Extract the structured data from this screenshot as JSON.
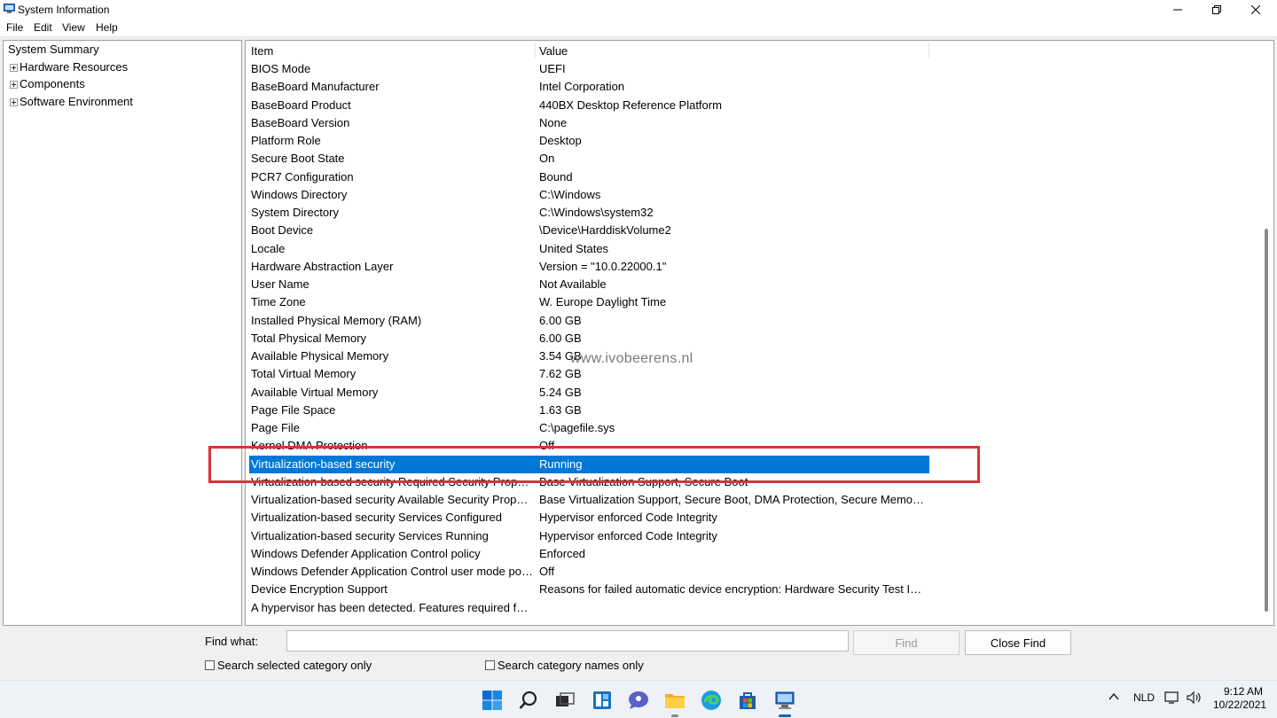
{
  "window": {
    "title": "System Information",
    "icon": "system-information-icon",
    "controls": [
      "minimize-icon",
      "restore-icon",
      "close-icon"
    ]
  },
  "menu": [
    "File",
    "Edit",
    "View",
    "Help"
  ],
  "tree": {
    "root": "System Summary",
    "children": [
      "Hardware Resources",
      "Components",
      "Software Environment"
    ]
  },
  "table": {
    "columns": [
      "Item",
      "Value"
    ],
    "rows": [
      {
        "item": "BIOS Mode",
        "value": "UEFI"
      },
      {
        "item": "BaseBoard Manufacturer",
        "value": "Intel Corporation"
      },
      {
        "item": "BaseBoard Product",
        "value": "440BX Desktop Reference Platform"
      },
      {
        "item": "BaseBoard Version",
        "value": "None"
      },
      {
        "item": "Platform Role",
        "value": "Desktop"
      },
      {
        "item": "Secure Boot State",
        "value": "On"
      },
      {
        "item": "PCR7 Configuration",
        "value": "Bound"
      },
      {
        "item": "Windows Directory",
        "value": "C:\\Windows"
      },
      {
        "item": "System Directory",
        "value": "C:\\Windows\\system32"
      },
      {
        "item": "Boot Device",
        "value": "\\Device\\HarddiskVolume2"
      },
      {
        "item": "Locale",
        "value": "United States"
      },
      {
        "item": "Hardware Abstraction Layer",
        "value": "Version = \"10.0.22000.1\""
      },
      {
        "item": "User Name",
        "value": "Not Available"
      },
      {
        "item": "Time Zone",
        "value": "W. Europe Daylight Time"
      },
      {
        "item": "Installed Physical Memory (RAM)",
        "value": "6.00 GB"
      },
      {
        "item": "Total Physical Memory",
        "value": "6.00 GB"
      },
      {
        "item": "Available Physical Memory",
        "value": "3.54 GB"
      },
      {
        "item": "Total Virtual Memory",
        "value": "7.62 GB"
      },
      {
        "item": "Available Virtual Memory",
        "value": "5.24 GB"
      },
      {
        "item": "Page File Space",
        "value": "1.63 GB"
      },
      {
        "item": "Page File",
        "value": "C:\\pagefile.sys"
      },
      {
        "item": "Kernel DMA Protection",
        "value": "Off"
      },
      {
        "item": "Virtualization-based security",
        "value": "Running",
        "selected": true
      },
      {
        "item": "Virtualization-based security Required Security Proper...",
        "value": "Base Virtualization Support, Secure Boot"
      },
      {
        "item": "Virtualization-based security Available Security Proper...",
        "value": "Base Virtualization Support, Secure Boot, DMA Protection, Secure Memory..."
      },
      {
        "item": "Virtualization-based security Services Configured",
        "value": "Hypervisor enforced Code Integrity"
      },
      {
        "item": "Virtualization-based security Services Running",
        "value": "Hypervisor enforced Code Integrity"
      },
      {
        "item": "Windows Defender Application Control policy",
        "value": "Enforced"
      },
      {
        "item": "Windows Defender Application Control user mode pol...",
        "value": "Off"
      },
      {
        "item": "Device Encryption Support",
        "value": "Reasons for failed automatic device encryption: Hardware Security Test Int..."
      },
      {
        "item": "A hypervisor has been detected. Features required for ...",
        "value": ""
      }
    ]
  },
  "watermark": "www.ivobeerens.nl",
  "find": {
    "label": "Find what:",
    "value": "",
    "find_button": "Find",
    "close_button": "Close Find",
    "option_selected_category": "Search selected category only",
    "option_category_names": "Search category names only"
  },
  "taskbar": {
    "icons": [
      "start-icon",
      "search-icon",
      "task-view-icon",
      "widgets-icon",
      "chat-icon",
      "file-explorer-icon",
      "edge-icon",
      "store-icon",
      "system-information-icon"
    ],
    "tray": {
      "language": "NLD",
      "time": "9:12 AM",
      "date": "10/22/2021"
    }
  },
  "colors": {
    "selection": "#0078d7",
    "highlight_box": "#d9343a",
    "accent": "#0067c0"
  }
}
